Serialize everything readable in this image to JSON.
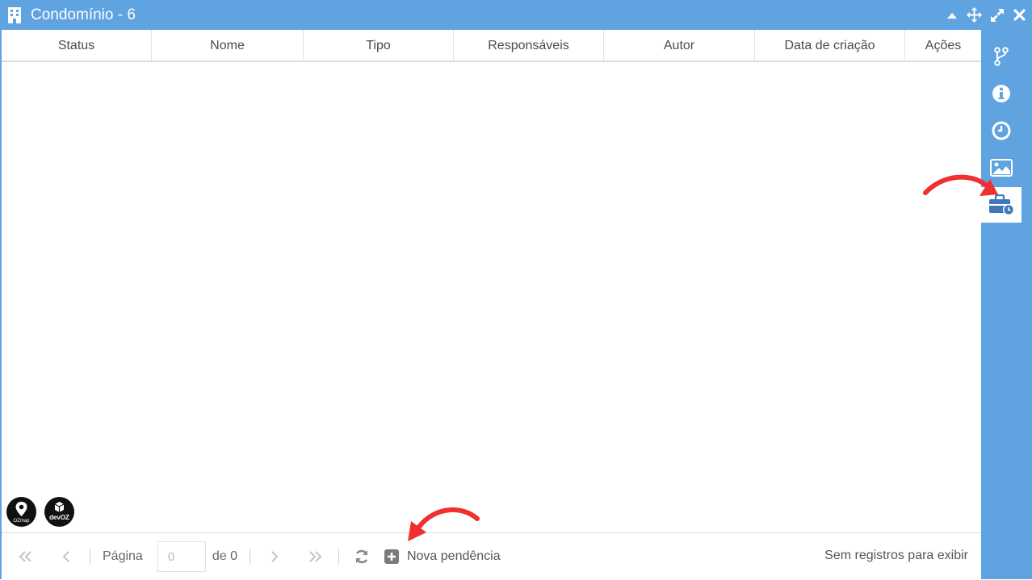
{
  "window": {
    "title": "Condomínio - 6",
    "title_icon": "building-icon",
    "controls": [
      "collapse-icon",
      "move-icon",
      "maximize-icon",
      "close-icon"
    ]
  },
  "table": {
    "columns": [
      "Status",
      "Nome",
      "Tipo",
      "Responsáveis",
      "Autor",
      "Data de criação",
      "Ações"
    ],
    "rows": []
  },
  "logos": [
    "OZmap",
    "devOZ"
  ],
  "footer": {
    "page_label": "Página",
    "page_value": "0",
    "of_label": "de 0",
    "new_button_label": "Nova pendência",
    "status_text": "Sem registros para exibir"
  },
  "sidebar": {
    "items": [
      "branch-icon",
      "info-icon",
      "clock-icon",
      "image-icon",
      "briefcase-clock-icon"
    ],
    "active": "briefcase-clock-icon"
  },
  "colors": {
    "accent": "#5fa3e0",
    "active_icon": "#3d78b8",
    "annotation_arrow": "#f03030"
  }
}
